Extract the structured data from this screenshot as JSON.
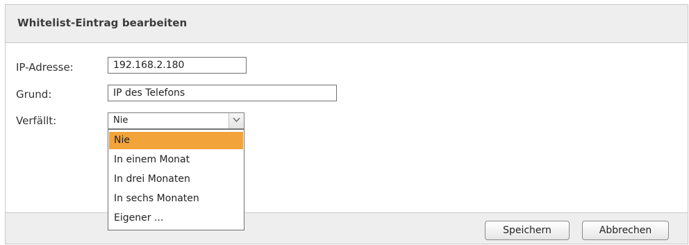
{
  "dialog": {
    "title": "Whitelist-Eintrag bearbeiten"
  },
  "form": {
    "ip": {
      "label": "IP-Adresse:",
      "value": "192.168.2.180"
    },
    "reason": {
      "label": "Grund:",
      "value": "IP des Telefons"
    },
    "expires": {
      "label": "Verfällt:",
      "selected": "Nie",
      "options": [
        "Nie",
        "In einem Monat",
        "In drei Monaten",
        "In sechs Monaten",
        "Eigener ..."
      ],
      "highlighted_index": 0
    }
  },
  "buttons": {
    "save": "Speichern",
    "cancel": "Abbrechen"
  },
  "colors": {
    "highlight": "#f2a33a",
    "header_bg": "#eeeeee"
  },
  "icons": {
    "dropdown_arrow": "chevron-down-icon"
  }
}
